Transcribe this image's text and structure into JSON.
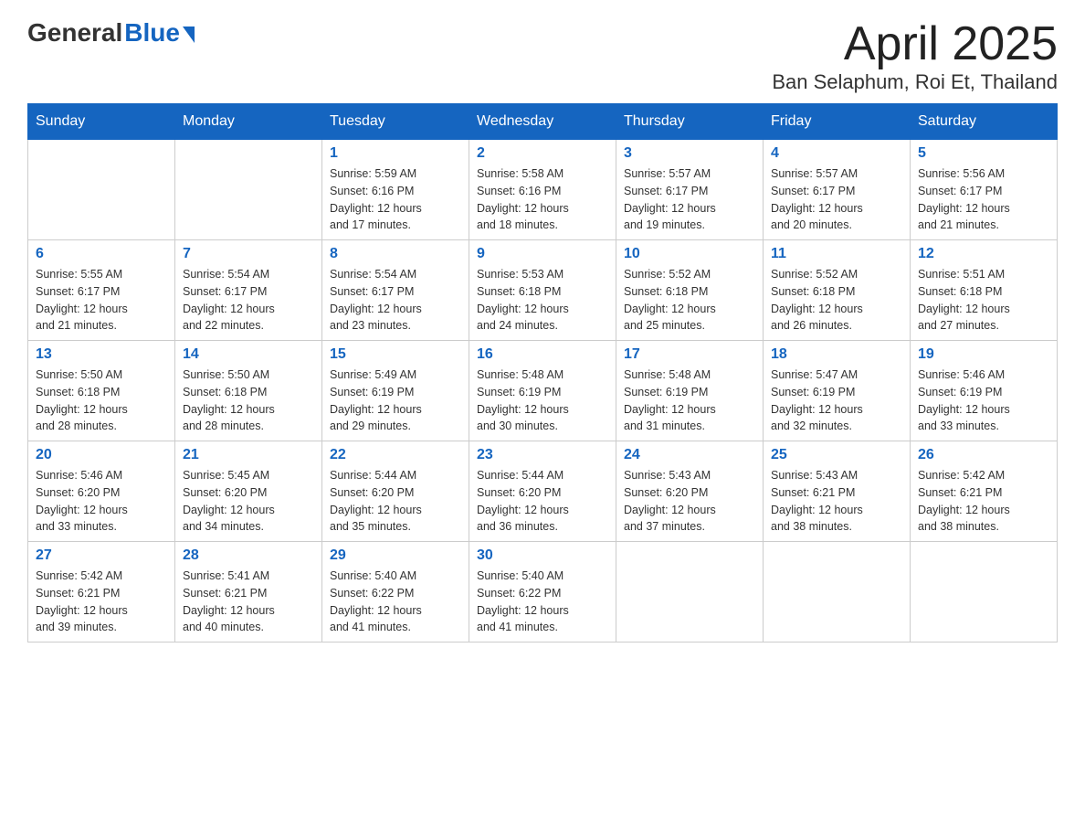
{
  "header": {
    "logo_general": "General",
    "logo_blue": "Blue",
    "title": "April 2025",
    "location": "Ban Selaphum, Roi Et, Thailand"
  },
  "weekdays": [
    "Sunday",
    "Monday",
    "Tuesday",
    "Wednesday",
    "Thursday",
    "Friday",
    "Saturday"
  ],
  "weeks": [
    [
      {
        "day": "",
        "info": ""
      },
      {
        "day": "",
        "info": ""
      },
      {
        "day": "1",
        "info": "Sunrise: 5:59 AM\nSunset: 6:16 PM\nDaylight: 12 hours\nand 17 minutes."
      },
      {
        "day": "2",
        "info": "Sunrise: 5:58 AM\nSunset: 6:16 PM\nDaylight: 12 hours\nand 18 minutes."
      },
      {
        "day": "3",
        "info": "Sunrise: 5:57 AM\nSunset: 6:17 PM\nDaylight: 12 hours\nand 19 minutes."
      },
      {
        "day": "4",
        "info": "Sunrise: 5:57 AM\nSunset: 6:17 PM\nDaylight: 12 hours\nand 20 minutes."
      },
      {
        "day": "5",
        "info": "Sunrise: 5:56 AM\nSunset: 6:17 PM\nDaylight: 12 hours\nand 21 minutes."
      }
    ],
    [
      {
        "day": "6",
        "info": "Sunrise: 5:55 AM\nSunset: 6:17 PM\nDaylight: 12 hours\nand 21 minutes."
      },
      {
        "day": "7",
        "info": "Sunrise: 5:54 AM\nSunset: 6:17 PM\nDaylight: 12 hours\nand 22 minutes."
      },
      {
        "day": "8",
        "info": "Sunrise: 5:54 AM\nSunset: 6:17 PM\nDaylight: 12 hours\nand 23 minutes."
      },
      {
        "day": "9",
        "info": "Sunrise: 5:53 AM\nSunset: 6:18 PM\nDaylight: 12 hours\nand 24 minutes."
      },
      {
        "day": "10",
        "info": "Sunrise: 5:52 AM\nSunset: 6:18 PM\nDaylight: 12 hours\nand 25 minutes."
      },
      {
        "day": "11",
        "info": "Sunrise: 5:52 AM\nSunset: 6:18 PM\nDaylight: 12 hours\nand 26 minutes."
      },
      {
        "day": "12",
        "info": "Sunrise: 5:51 AM\nSunset: 6:18 PM\nDaylight: 12 hours\nand 27 minutes."
      }
    ],
    [
      {
        "day": "13",
        "info": "Sunrise: 5:50 AM\nSunset: 6:18 PM\nDaylight: 12 hours\nand 28 minutes."
      },
      {
        "day": "14",
        "info": "Sunrise: 5:50 AM\nSunset: 6:18 PM\nDaylight: 12 hours\nand 28 minutes."
      },
      {
        "day": "15",
        "info": "Sunrise: 5:49 AM\nSunset: 6:19 PM\nDaylight: 12 hours\nand 29 minutes."
      },
      {
        "day": "16",
        "info": "Sunrise: 5:48 AM\nSunset: 6:19 PM\nDaylight: 12 hours\nand 30 minutes."
      },
      {
        "day": "17",
        "info": "Sunrise: 5:48 AM\nSunset: 6:19 PM\nDaylight: 12 hours\nand 31 minutes."
      },
      {
        "day": "18",
        "info": "Sunrise: 5:47 AM\nSunset: 6:19 PM\nDaylight: 12 hours\nand 32 minutes."
      },
      {
        "day": "19",
        "info": "Sunrise: 5:46 AM\nSunset: 6:19 PM\nDaylight: 12 hours\nand 33 minutes."
      }
    ],
    [
      {
        "day": "20",
        "info": "Sunrise: 5:46 AM\nSunset: 6:20 PM\nDaylight: 12 hours\nand 33 minutes."
      },
      {
        "day": "21",
        "info": "Sunrise: 5:45 AM\nSunset: 6:20 PM\nDaylight: 12 hours\nand 34 minutes."
      },
      {
        "day": "22",
        "info": "Sunrise: 5:44 AM\nSunset: 6:20 PM\nDaylight: 12 hours\nand 35 minutes."
      },
      {
        "day": "23",
        "info": "Sunrise: 5:44 AM\nSunset: 6:20 PM\nDaylight: 12 hours\nand 36 minutes."
      },
      {
        "day": "24",
        "info": "Sunrise: 5:43 AM\nSunset: 6:20 PM\nDaylight: 12 hours\nand 37 minutes."
      },
      {
        "day": "25",
        "info": "Sunrise: 5:43 AM\nSunset: 6:21 PM\nDaylight: 12 hours\nand 38 minutes."
      },
      {
        "day": "26",
        "info": "Sunrise: 5:42 AM\nSunset: 6:21 PM\nDaylight: 12 hours\nand 38 minutes."
      }
    ],
    [
      {
        "day": "27",
        "info": "Sunrise: 5:42 AM\nSunset: 6:21 PM\nDaylight: 12 hours\nand 39 minutes."
      },
      {
        "day": "28",
        "info": "Sunrise: 5:41 AM\nSunset: 6:21 PM\nDaylight: 12 hours\nand 40 minutes."
      },
      {
        "day": "29",
        "info": "Sunrise: 5:40 AM\nSunset: 6:22 PM\nDaylight: 12 hours\nand 41 minutes."
      },
      {
        "day": "30",
        "info": "Sunrise: 5:40 AM\nSunset: 6:22 PM\nDaylight: 12 hours\nand 41 minutes."
      },
      {
        "day": "",
        "info": ""
      },
      {
        "day": "",
        "info": ""
      },
      {
        "day": "",
        "info": ""
      }
    ]
  ]
}
